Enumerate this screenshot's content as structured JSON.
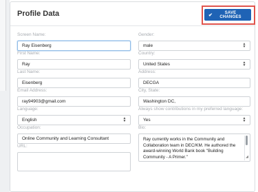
{
  "header": {
    "title": "Profile Data",
    "save_label": "SAVE CHANGES",
    "save_icon": "check-icon"
  },
  "left": [
    {
      "label": "Screen Name:",
      "value": "Ray Eisenberg"
    },
    {
      "label": "First Name:",
      "value": "Ray"
    },
    {
      "label": "Last Name:",
      "value": "Eisenberg"
    },
    {
      "label": "Email Address:",
      "value": "ray94903@gmail.com"
    },
    {
      "label": "Language:",
      "value": "English"
    },
    {
      "label": "Occupation:",
      "value": "Online Community and Learning Consultant"
    },
    {
      "label": "URL:",
      "value": ""
    }
  ],
  "right": [
    {
      "label": "Gender:",
      "value": "male"
    },
    {
      "label": "Country:",
      "value": "United States"
    },
    {
      "label": "Address:",
      "value": "DECGA"
    },
    {
      "label": "City, State:",
      "value": "Washington DC,"
    },
    {
      "label": "Always show contributions in my preferred language:",
      "value": "Yes"
    },
    {
      "label": "Bio:",
      "value": "Ray currently works in the Community and Collaboration team in DEC/KM.  He authored the award-winning World Bank book \"Building Community - A Primer.\""
    }
  ]
}
